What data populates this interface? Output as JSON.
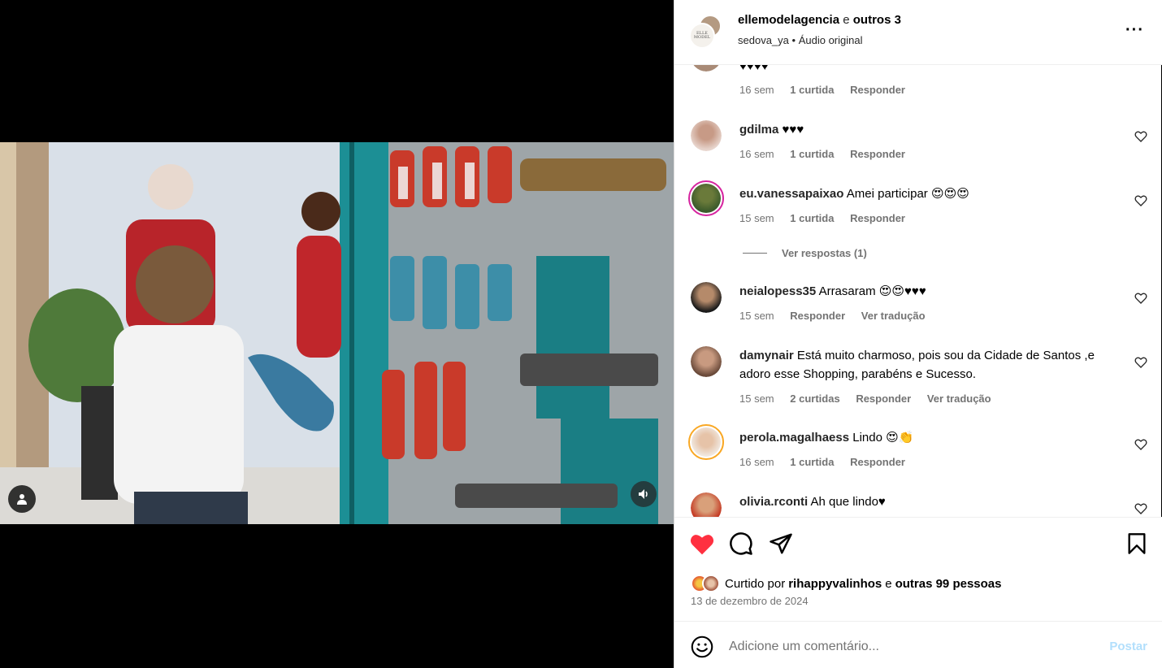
{
  "header": {
    "author": "ellemodelagencia",
    "joiner": "e",
    "others": "outros 3",
    "audio_user": "sedova_ya",
    "bullet": "•",
    "audio_label": "Áudio original",
    "avatar_logo_text": "ELLE MODEL"
  },
  "comments": [
    {
      "id": "partial",
      "user": "",
      "text": "♥♥♥♥",
      "time": "16 sem",
      "likes": "1 curtida",
      "reply": "Responder"
    },
    {
      "id": "gdilma",
      "user": "gdilma",
      "text": "♥♥♥",
      "time": "16 sem",
      "likes": "1 curtida",
      "reply": "Responder"
    },
    {
      "id": "vanessa",
      "user": "eu.vanessapaixao",
      "text": "Amei participar 😍😍😍",
      "time": "15 sem",
      "likes": "1 curtida",
      "reply": "Responder",
      "view_replies": "Ver respostas (1)"
    },
    {
      "id": "neia",
      "user": "neialopess35",
      "text": "Arrasaram 😍😍♥♥♥",
      "time": "15 sem",
      "reply": "Responder",
      "translate": "Ver tradução"
    },
    {
      "id": "damy",
      "user": "damynair",
      "text": "Está muito charmoso, pois sou da Cidade de Santos ,e adoro esse Shopping, parabéns e Sucesso.",
      "time": "15 sem",
      "likes": "2 curtidas",
      "reply": "Responder",
      "translate": "Ver tradução"
    },
    {
      "id": "perola",
      "user": "perola.magalhaess",
      "text": "Lindo 😍👏",
      "time": "16 sem",
      "likes": "1 curtida",
      "reply": "Responder"
    },
    {
      "id": "olivia",
      "user": "olivia.rconti",
      "text": "Ah que lindo♥"
    }
  ],
  "footer": {
    "liked_prefix": "Curtido por",
    "liked_user": "rihappyvalinhos",
    "liked_joiner": "e",
    "liked_others": "outras 99 pessoas",
    "date": "13 de dezembro de 2024",
    "comment_placeholder": "Adicione um comentário...",
    "post_label": "Postar"
  },
  "colors": {
    "like_red": "#ff3040",
    "post_disabled": "#b2dffc",
    "meta_gray": "#737373"
  },
  "icons": [
    "heart-icon",
    "comment-icon",
    "share-icon",
    "save-icon",
    "more-icon",
    "emoji-icon",
    "user-tag-icon",
    "volume-icon"
  ]
}
